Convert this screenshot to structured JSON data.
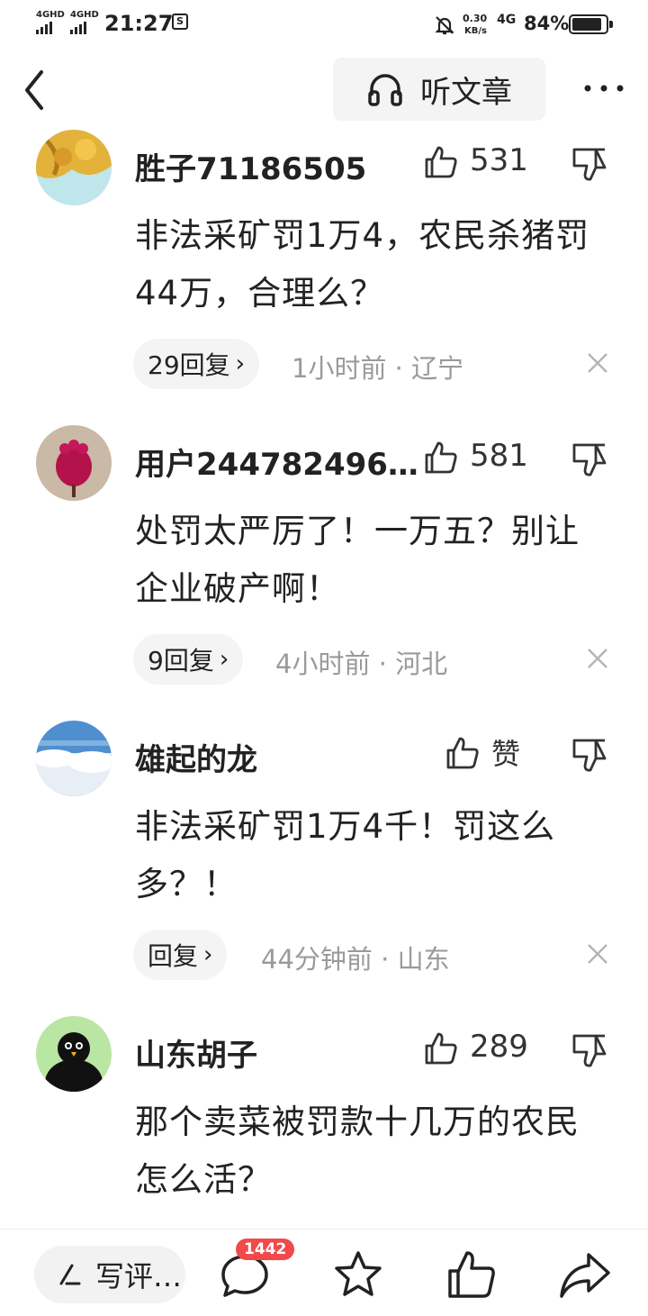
{
  "status_bar": {
    "signal1": "4GHD",
    "signal2": "4GHD",
    "time": "21:27",
    "notification_icon": "S",
    "net_speed_value": "0.30",
    "net_speed_unit": "KB/s",
    "network": "4G",
    "battery": "84%"
  },
  "nav": {
    "listen_label": "听文章"
  },
  "comments": [
    {
      "username": "胜子71186505",
      "likes": "531",
      "text": "非法采矿罚1万4，农民杀猪罚44万，合理么？",
      "replies": "29回复",
      "time": "1小时前",
      "location": "辽宁"
    },
    {
      "username": "用户244782496…",
      "likes": "581",
      "text": "处罚太严厉了！一万五？别让企业破产啊！",
      "replies": "9回复",
      "time": "4小时前",
      "location": "河北"
    },
    {
      "username": "雄起的龙",
      "likes": "赞",
      "text": "非法采矿罚1万4千！罚这么多？！",
      "replies": "回复",
      "time": "44分钟前",
      "location": "山东"
    },
    {
      "username": "山东胡子",
      "likes": "289",
      "text": "那个卖菜被罚款十几万的农民怎么活？"
    }
  ],
  "bottom_bar": {
    "write_label": "写评…",
    "comment_count": "1442"
  },
  "icons": [
    "back-arrow-icon",
    "headphones-icon",
    "more-dots-icon",
    "thumbs-up-icon",
    "thumbs-down-icon",
    "close-icon",
    "pen-icon",
    "comment-bubble-icon",
    "star-icon",
    "share-icon"
  ]
}
